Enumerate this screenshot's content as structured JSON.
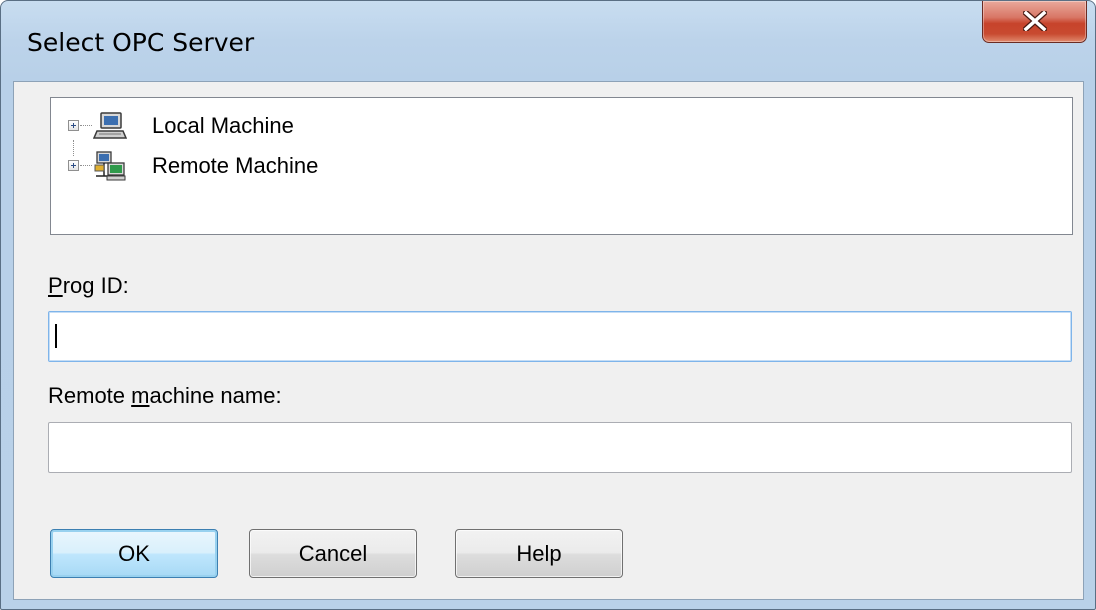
{
  "window": {
    "title": "Select OPC Server"
  },
  "tree": {
    "items": [
      {
        "label": "Local Machine",
        "icon": "computer-icon"
      },
      {
        "label": "Remote Machine",
        "icon": "network-computer-icon"
      }
    ]
  },
  "prog_id": {
    "label_accel": "P",
    "label_rest": "rog ID:",
    "value": ""
  },
  "remote_machine": {
    "label_pre": "Remote ",
    "label_accel": "m",
    "label_rest": "achine name:",
    "value": ""
  },
  "buttons": {
    "ok": "OK",
    "cancel": "Cancel",
    "help": "Help"
  },
  "colors": {
    "close_button": "#c7432b",
    "focus_border": "#7eb4ea",
    "default_button_border": "#3c7fb1"
  }
}
